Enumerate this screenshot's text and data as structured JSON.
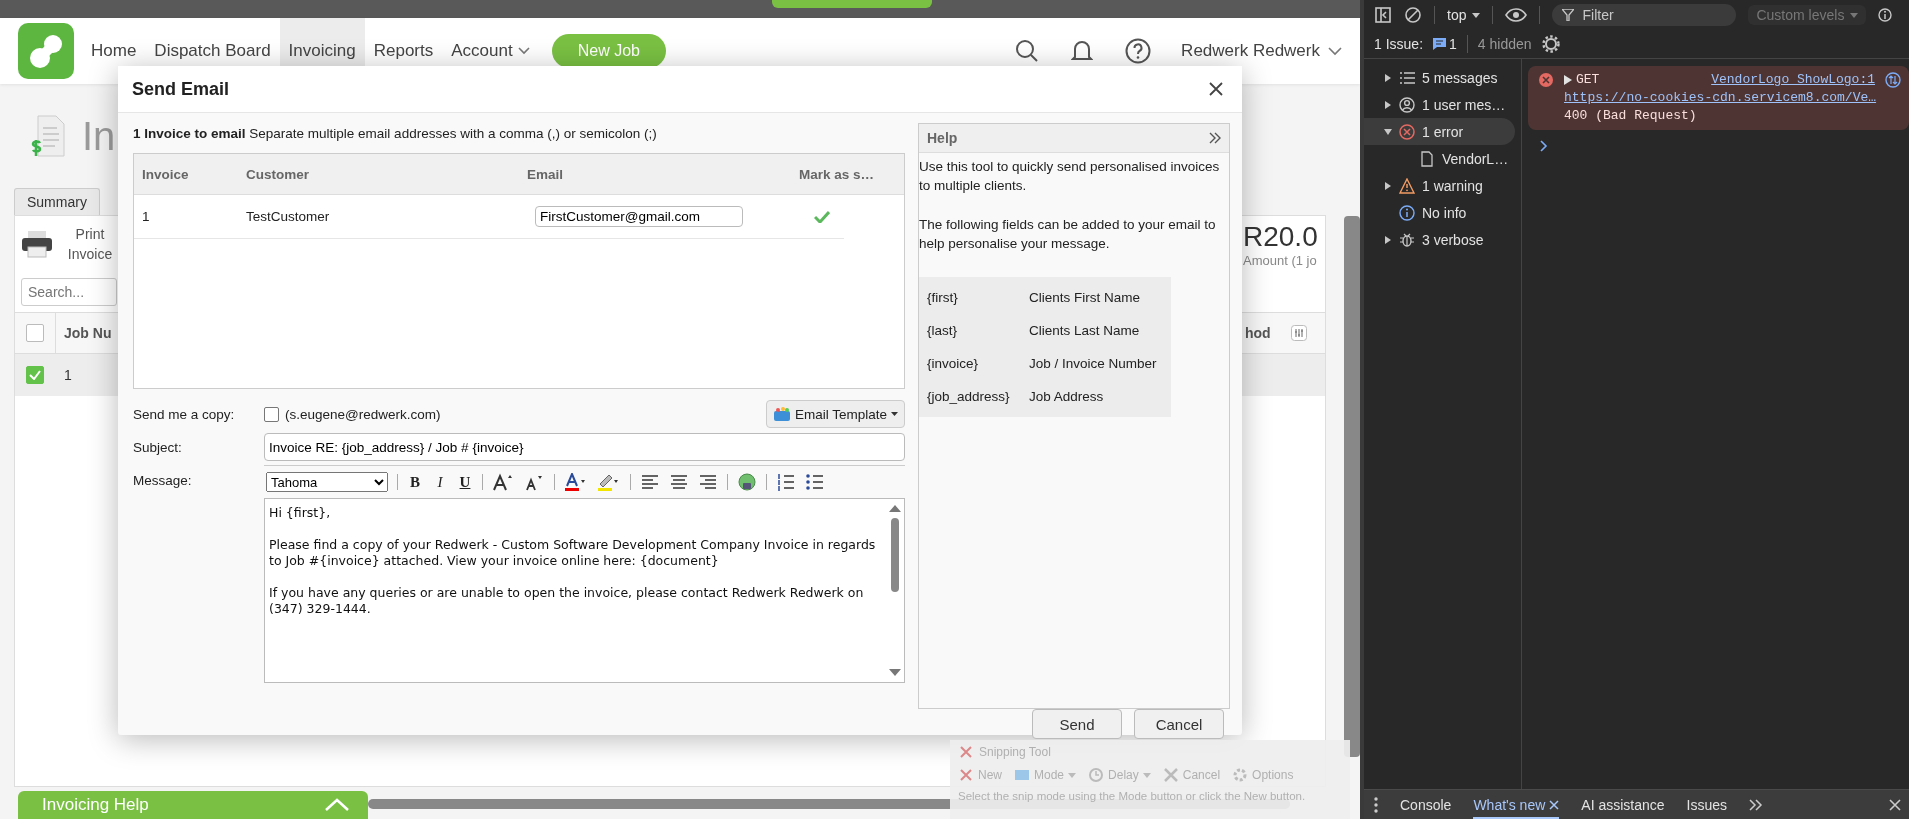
{
  "app": {
    "nav": [
      {
        "label": "Home",
        "selected": false
      },
      {
        "label": "Dispatch Board",
        "selected": false
      },
      {
        "label": "Invoicing",
        "selected": true
      },
      {
        "label": "Reports",
        "selected": false
      },
      {
        "label": "Account",
        "selected": false
      }
    ],
    "new_job_button": "New Job",
    "user_name": "Redwerk Redwerk",
    "page_title": "In",
    "tab": "Summary",
    "print_button": "Print Invoice",
    "search": {
      "placeholder": "Search..."
    },
    "total": {
      "amount": "R20.0",
      "caption": "Amount (1 jo"
    },
    "table": {
      "header_checked": false,
      "column_1": "Job Nu",
      "column_last": "hod",
      "rows": [
        {
          "checked": true,
          "job_number": "1"
        }
      ]
    },
    "help_bar": "Invoicing Help"
  },
  "dialog": {
    "title": "Send Email",
    "intro": "**1 Invoice to email** Separate multiple email addresses with a comma (,) or semicolon (;)",
    "columns": [
      "Invoice",
      "Customer",
      "Email",
      "Mark as s…"
    ],
    "rows": [
      {
        "invoice": "1",
        "customer": "TestCustomer",
        "email": "FirstCustomer@gmail.com",
        "mark_as_sent": true
      }
    ],
    "send_copy": {
      "label": "Send me a copy:",
      "checked": false,
      "address": "(s.eugene@redwerk.com)"
    },
    "template_button": "Email Template",
    "subject": {
      "label": "Subject:",
      "value": "Invoice RE: {job_address} / Job # {invoice}"
    },
    "message": {
      "label": "Message:",
      "font": "Tahoma",
      "format_buttons": [
        {
          "kind": "bold",
          "glyph": "B"
        },
        {
          "kind": "italic",
          "glyph": "I"
        },
        {
          "kind": "underline",
          "glyph": "U"
        }
      ],
      "paragraphs": [
        "Hi {first},",
        "Please find a copy of your Redwerk - Custom Software Development Company Invoice in regards to Job #{invoice} attached. View your invoice online here: {document}",
        "If you have any queries or are unable to open the invoice, please contact Redwerk Redwerk on (347) 329-1444."
      ]
    },
    "help": {
      "title": "Help",
      "paragraphs": [
        "Use this tool to quickly send personalised invoices to multiple clients.",
        "The following fields can be added to your email to help personalise your message."
      ],
      "fields": [
        {
          "code": "{first}",
          "meaning": "Clients First Name"
        },
        {
          "code": "{last}",
          "meaning": "Clients Last Name"
        },
        {
          "code": "{invoice}",
          "meaning": "Job / Invoice Number"
        },
        {
          "code": "{job_address}",
          "meaning": "Job Address"
        }
      ]
    },
    "buttons": [
      "Send",
      "Cancel"
    ]
  },
  "snipping_tool": {
    "title": "Snipping Tool",
    "tools": [
      {
        "kind": "new",
        "label": "New"
      },
      {
        "kind": "mode",
        "label": "Mode"
      },
      {
        "kind": "delay",
        "label": "Delay"
      },
      {
        "kind": "cancel",
        "label": "Cancel"
      },
      {
        "kind": "options",
        "label": "Options"
      }
    ],
    "hint": "Select the snip mode using the Mode button or click the New button."
  },
  "devtools": {
    "context": "top",
    "filter": {
      "placeholder": "Filter"
    },
    "levels": "Custom levels",
    "issues": {
      "label": "1 Issue:",
      "count": "1",
      "hidden": "4 hidden"
    },
    "sidebar": [
      {
        "kind": "messages",
        "label": "5 messages",
        "expanded": false,
        "selected": false
      },
      {
        "kind": "user",
        "label": "1 user mes…",
        "expanded": false,
        "selected": false
      },
      {
        "kind": "error",
        "label": "1 error",
        "expanded": true,
        "selected": true,
        "children": [
          {
            "kind": "file",
            "label": "VendorL…",
            "selected": false
          }
        ]
      },
      {
        "kind": "warning",
        "label": "1 warning",
        "expanded": false,
        "selected": false
      },
      {
        "kind": "info",
        "label": "No info",
        "selected": false
      },
      {
        "kind": "verbose",
        "label": "3 verbose",
        "expanded": false,
        "selected": false
      }
    ],
    "console": [
      {
        "method": "GET",
        "source": "VendorLogo_ShowLogo:1",
        "url": "https://no-cookies-cdn.servicem8.com/Ve…",
        "status": "400 (Bad Request)"
      }
    ],
    "tabs": [
      {
        "label": "Console",
        "selected": false
      },
      {
        "label": "What's new",
        "selected": true
      },
      {
        "label": "AI assistance",
        "selected": false
      },
      {
        "label": "Issues",
        "selected": false
      }
    ]
  }
}
